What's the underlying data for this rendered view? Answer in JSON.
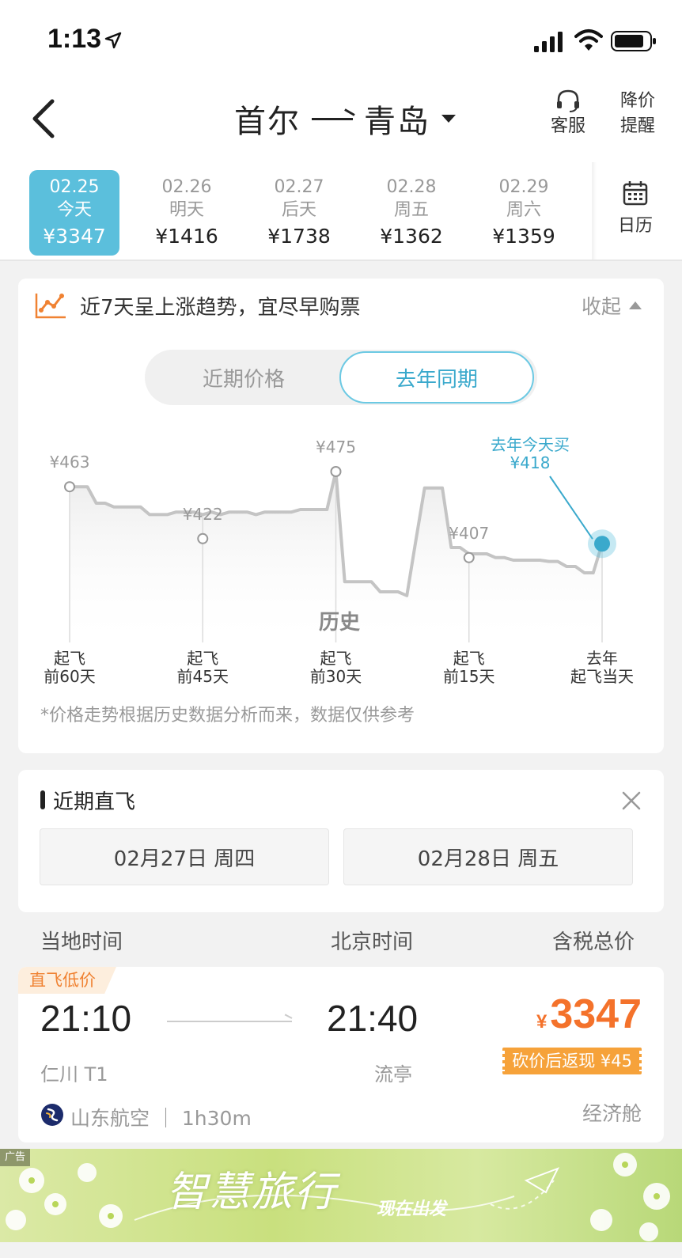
{
  "status_bar": {
    "time": "1:13"
  },
  "header": {
    "origin": "首尔",
    "destination": "青岛",
    "service_label": "客服",
    "price_alert_label_1": "降价",
    "price_alert_label_2": "提醒"
  },
  "dates": [
    {
      "date": "02.25",
      "day": "今天",
      "price": "¥3347",
      "selected": true
    },
    {
      "date": "02.26",
      "day": "明天",
      "price": "¥1416"
    },
    {
      "date": "02.27",
      "day": "后天",
      "price": "¥1738"
    },
    {
      "date": "02.28",
      "day": "周五",
      "price": "¥1362"
    },
    {
      "date": "02.29",
      "day": "周六",
      "price": "¥1359"
    }
  ],
  "calendar_label": "日历",
  "trend": {
    "title": "近7天呈上涨趋势，宜尽早购票",
    "collapse_label": "收起",
    "tabs": [
      "近期价格",
      "去年同期"
    ],
    "active_tab": "去年同期",
    "history_label": "历史",
    "callout_line1": "去年今天买",
    "callout_line2": "¥418",
    "disclaimer": "*价格走势根据历史数据分析而来，数据仅供参考"
  },
  "chart_data": {
    "type": "line",
    "series": [
      {
        "values": [
          463,
          463,
          463,
          450,
          450,
          447,
          447,
          447,
          447,
          441,
          441,
          441,
          443,
          443,
          443,
          441,
          443,
          441,
          443,
          443,
          443,
          441,
          443,
          443,
          443,
          443,
          445,
          445,
          445,
          445,
          475,
          388,
          388,
          388,
          388,
          380,
          380,
          380,
          377,
          420,
          462,
          462,
          462,
          415,
          415,
          410,
          410,
          410,
          407,
          407,
          405,
          405,
          405,
          405,
          404,
          404,
          400,
          400,
          395,
          395,
          418
        ]
      }
    ],
    "x_labels": [
      {
        "line1": "起飞",
        "line2": "前60天"
      },
      {
        "line1": "起飞",
        "line2": "前45天"
      },
      {
        "line1": "起飞",
        "line2": "前30天"
      },
      {
        "line1": "起飞",
        "line2": "前15天"
      },
      {
        "line1": "去年",
        "line2": "起飞当天"
      }
    ],
    "marker_labels": [
      "¥463",
      "¥422",
      "¥475",
      "¥407"
    ],
    "marker_values": [
      463,
      422,
      475,
      407
    ],
    "ylim": [
      340,
      490
    ],
    "grid": false,
    "highlight_value": 418
  },
  "direct": {
    "title": "近期直飞",
    "dates": [
      "02月27日 周四",
      "02月28日 周五"
    ]
  },
  "columns": {
    "local_time": "当地时间",
    "beijing_time": "北京时间",
    "total_price": "含税总价"
  },
  "flight": {
    "tag": "直飞低价",
    "dep_time": "21:10",
    "arr_time": "21:40",
    "dep_airport": "仁川 T1",
    "arr_airport": "流亭",
    "currency": "¥",
    "price": "3347",
    "cashback": "砍价后返现 ¥45",
    "airline": "山东航空 ｜ 1h30m",
    "cabin": "经济舱"
  },
  "ad": {
    "label": "广告",
    "title": "智慧旅行",
    "subtitle": "现在出发"
  },
  "colors": {
    "accent": "#5bbfdc",
    "price": "#f4722b",
    "cashback": "#f6a23a"
  }
}
